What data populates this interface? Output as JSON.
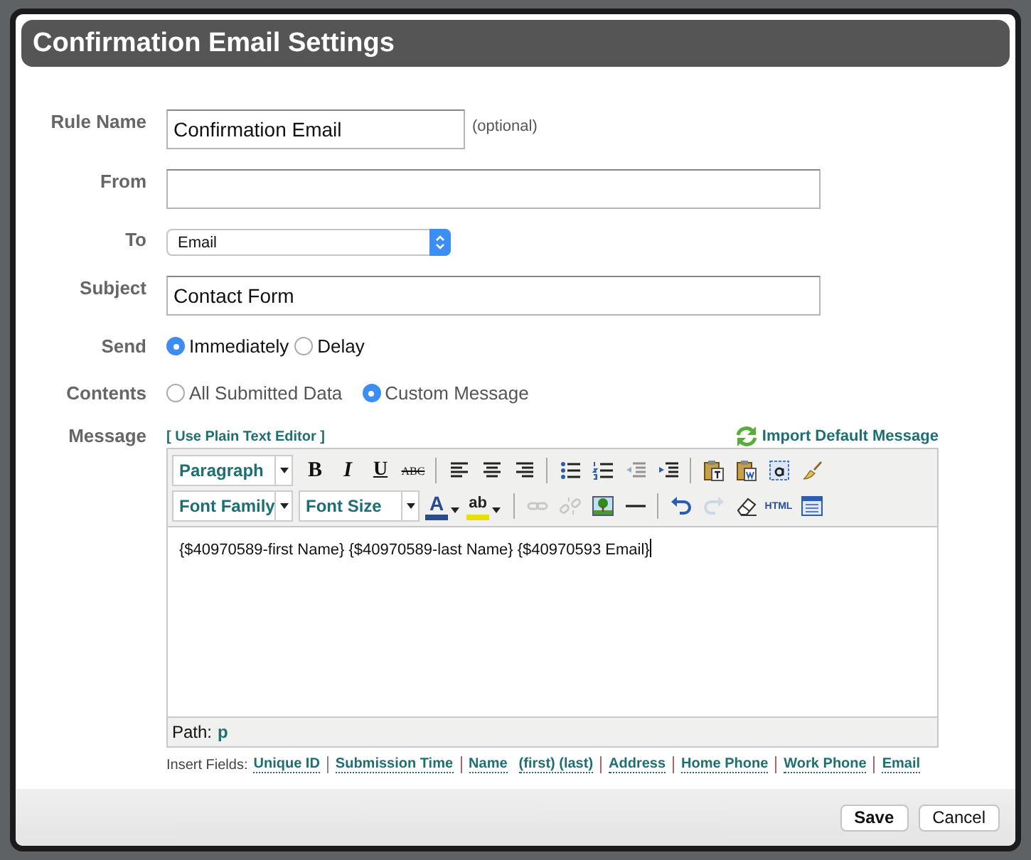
{
  "dialog": {
    "title": "Confirmation Email Settings"
  },
  "fields": [
    {
      "kind": "text",
      "label": "Rule Name",
      "value": "Confirmation Email",
      "note": "(optional)",
      "wide": false
    },
    {
      "kind": "text",
      "label": "From",
      "wide": true
    },
    {
      "kind": "select",
      "label": "To",
      "value": "Email"
    },
    {
      "kind": "text",
      "label": "Subject",
      "value": "Contact Form",
      "wide": true
    },
    {
      "kind": "radio",
      "label": "Send",
      "options": [
        {
          "label": "Immediately",
          "selected": true
        },
        {
          "label": "Delay",
          "selected": false
        }
      ]
    },
    {
      "kind": "radio",
      "label": "Contents",
      "options": [
        {
          "label": "All Submitted Data",
          "selected": false
        },
        {
          "label": "Custom Message",
          "selected": true
        }
      ]
    }
  ],
  "message": {
    "label": "Message",
    "plain_text_link": "[ Use Plain Text Editor ]",
    "import_link": "Import Default Message",
    "toolbar": [
      [
        {
          "kind": "select",
          "label": "Paragraph"
        },
        {
          "kind": "bold",
          "label": "B"
        },
        {
          "kind": "italic",
          "label": "I"
        },
        {
          "kind": "underline",
          "label": "U"
        },
        {
          "kind": "strike",
          "label": "ABC"
        },
        {
          "kind": "separator"
        },
        {
          "kind": "icon",
          "disabled": false
        },
        {
          "kind": "icon",
          "disabled": false
        },
        {
          "kind": "icon",
          "disabled": false
        },
        {
          "kind": "separator"
        },
        {
          "kind": "icon",
          "disabled": false
        },
        {
          "kind": "icon",
          "disabled": false
        },
        {
          "kind": "icon",
          "disabled": true
        },
        {
          "kind": "icon",
          "disabled": false
        },
        {
          "kind": "separator"
        },
        {
          "kind": "icon",
          "disabled": false
        },
        {
          "kind": "icon",
          "disabled": false
        },
        {
          "kind": "icon",
          "disabled": false
        },
        {
          "kind": "icon",
          "disabled": false
        }
      ],
      [
        {
          "kind": "select",
          "label": "Font Family"
        },
        {
          "kind": "select",
          "label": "Font Size"
        },
        {
          "kind": "color",
          "label": "A",
          "color": "#2b4c8c"
        },
        {
          "kind": "color",
          "label": "ab",
          "color": "#e8e000"
        },
        {
          "kind": "separator"
        },
        {
          "kind": "icon",
          "disabled": true
        },
        {
          "kind": "icon",
          "disabled": true
        },
        {
          "kind": "icon",
          "disabled": false
        },
        {
          "kind": "icon",
          "disabled": false
        },
        {
          "kind": "separator"
        },
        {
          "kind": "icon",
          "disabled": false
        },
        {
          "kind": "icon",
          "disabled": true
        },
        {
          "kind": "icon",
          "disabled": false
        },
        {
          "kind": "html",
          "label": "HTML"
        },
        {
          "kind": "icon",
          "disabled": false
        }
      ]
    ],
    "body": "{$40970589-first Name} {$40970589-last Name} {$40970593 Email}",
    "path_label": "Path:",
    "path_value": "p"
  },
  "insert_fields": {
    "label": "Insert Fields:",
    "groups": [
      [
        "Unique ID"
      ],
      [
        "Submission Time"
      ],
      [
        "Name",
        "(first) (last)"
      ],
      [
        "Address"
      ],
      [
        "Home Phone"
      ],
      [
        "Work Phone"
      ],
      [
        "Email"
      ]
    ]
  },
  "buttons": [
    {
      "label": "Save",
      "primary": true
    },
    {
      "label": "Cancel",
      "primary": false
    }
  ]
}
